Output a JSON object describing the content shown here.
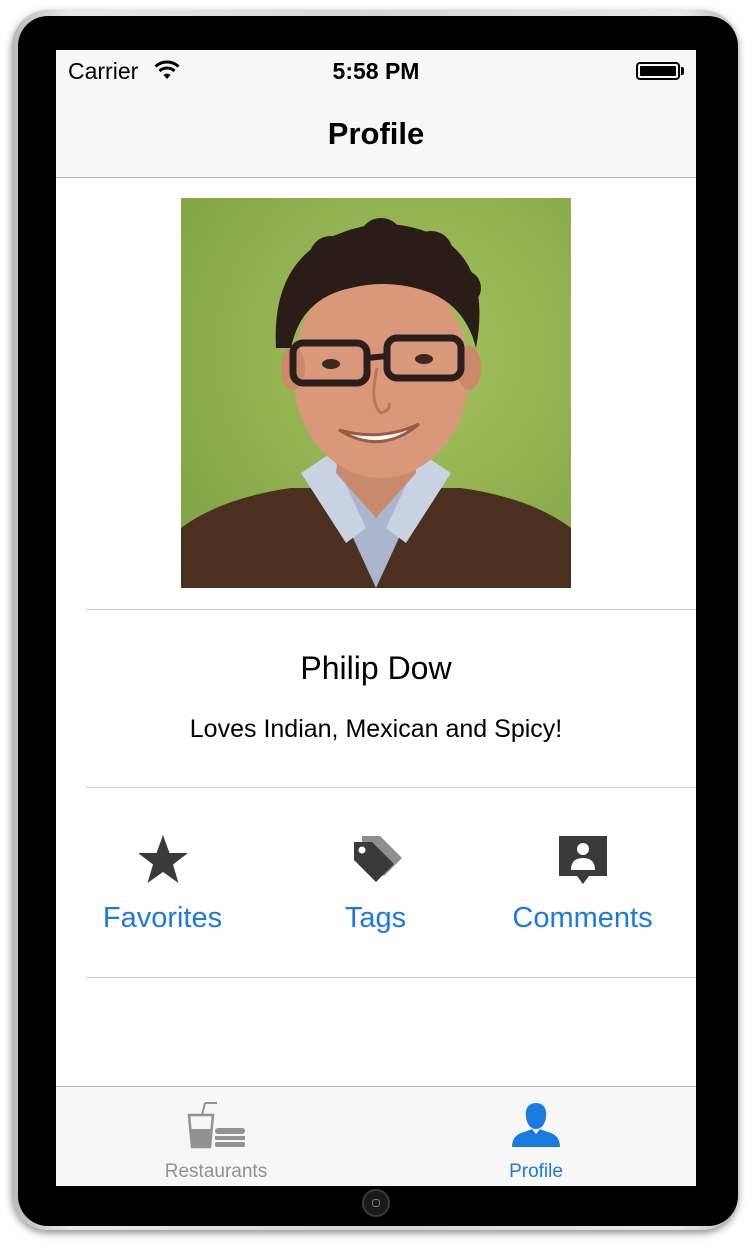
{
  "status_bar": {
    "carrier": "Carrier",
    "time": "5:58 PM"
  },
  "nav": {
    "title": "Profile"
  },
  "profile": {
    "name": "Philip Dow",
    "bio": "Loves Indian, Mexican and Spicy!",
    "photo_icon": "profile-photo"
  },
  "actions": [
    {
      "label": "Favorites",
      "icon": "star-icon"
    },
    {
      "label": "Tags",
      "icon": "tags-icon"
    },
    {
      "label": "Comments",
      "icon": "comment-icon"
    }
  ],
  "tabbar": {
    "tabs": [
      {
        "label": "Restaurants",
        "icon": "restaurants-icon",
        "selected": false
      },
      {
        "label": "Profile",
        "icon": "person-icon",
        "selected": true
      }
    ]
  },
  "colors": {
    "accent": "#1a7ae0",
    "inactive_tab": "#929292",
    "icon_gray": "#3a3a3a"
  }
}
